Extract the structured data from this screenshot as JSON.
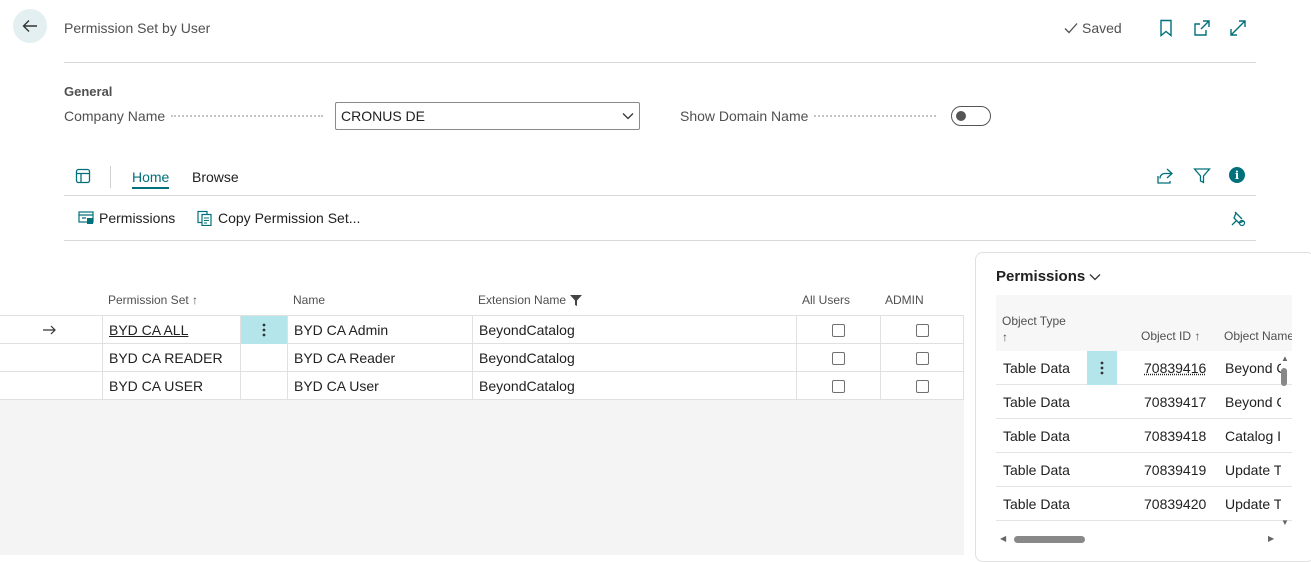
{
  "header": {
    "title": "Permission Set by User",
    "saved_label": "Saved"
  },
  "general": {
    "section_title": "General",
    "company_label": "Company Name",
    "company_value": "CRONUS DE",
    "domain_label": "Show Domain Name",
    "domain_toggle_on": false
  },
  "tabs": {
    "home": "Home",
    "browse": "Browse"
  },
  "actions": {
    "permissions": "Permissions",
    "copy": "Copy Permission Set..."
  },
  "table": {
    "columns": {
      "permission_set": "Permission Set",
      "name": "Name",
      "extension_name": "Extension Name",
      "all_users": "All Users",
      "admin": "ADMIN"
    },
    "rows": [
      {
        "permission_set": "BYD CA ALL",
        "name": "BYD CA Admin",
        "extension": "BeyondCatalog",
        "all_users": false,
        "admin": false
      },
      {
        "permission_set": "BYD CA READER",
        "name": "BYD CA Reader",
        "extension": "BeyondCatalog",
        "all_users": false,
        "admin": false
      },
      {
        "permission_set": "BYD CA USER",
        "name": "BYD CA User",
        "extension": "BeyondCatalog",
        "all_users": false,
        "admin": false
      }
    ]
  },
  "factbox": {
    "title": "Permissions",
    "columns": {
      "object_type": "Object Type",
      "object_id": "Object ID",
      "object_name": "Object Name"
    },
    "rows": [
      {
        "object_type": "Table Data",
        "object_id": "70839416",
        "object_name": "Beyond C"
      },
      {
        "object_type": "Table Data",
        "object_id": "70839417",
        "object_name": "Beyond C"
      },
      {
        "object_type": "Table Data",
        "object_id": "70839418",
        "object_name": "Catalog I"
      },
      {
        "object_type": "Table Data",
        "object_id": "70839419",
        "object_name": "Update T"
      },
      {
        "object_type": "Table Data",
        "object_id": "70839420",
        "object_name": "Update T"
      }
    ]
  },
  "colors": {
    "accent": "#00707a",
    "selected_cell": "#b3e5ea"
  }
}
